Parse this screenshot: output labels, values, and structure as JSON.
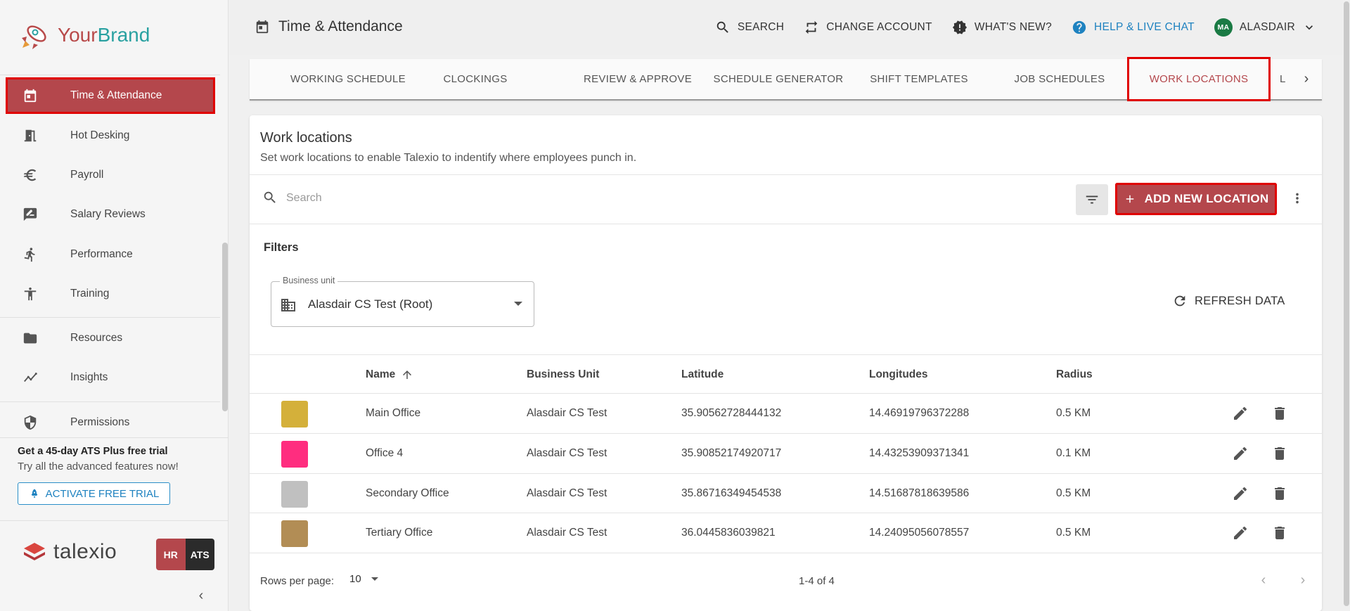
{
  "brand": {
    "part1": "Your",
    "part2": "Brand"
  },
  "sidebar": {
    "items": [
      {
        "label": "Time & Attendance",
        "icon": "calendar-icon"
      },
      {
        "label": "Hot Desking",
        "icon": "door-icon"
      },
      {
        "label": "Payroll",
        "icon": "euro-icon"
      },
      {
        "label": "Salary Reviews",
        "icon": "rate-review-icon"
      },
      {
        "label": "Performance",
        "icon": "running-person-icon"
      },
      {
        "label": "Training",
        "icon": "accessibility-icon"
      },
      {
        "label": "Resources",
        "icon": "folder-icon"
      },
      {
        "label": "Insights",
        "icon": "insights-icon"
      },
      {
        "label": "Permissions",
        "icon": "shield-icon"
      }
    ],
    "promo_title": "Get a 45-day ATS Plus free trial",
    "promo_sub": "Try all the advanced features now!",
    "trial_button": "ACTIVATE FREE TRIAL",
    "talexio": "talexio",
    "hr": "HR",
    "ats": "ATS"
  },
  "header": {
    "title": "Time & Attendance",
    "search": "SEARCH",
    "change_account": "CHANGE ACCOUNT",
    "whats_new": "WHAT'S NEW?",
    "help": "HELP & LIVE CHAT",
    "avatar_initials": "MA",
    "user": "ALASDAIR"
  },
  "tabs": [
    "WORKING SCHEDULE",
    "CLOCKINGS",
    "REVIEW & APPROVE",
    "SCHEDULE GENERATOR",
    "SHIFT TEMPLATES",
    "JOB SCHEDULES",
    "WORK LOCATIONS",
    "L"
  ],
  "card": {
    "title": "Work locations",
    "subtitle": "Set work locations to enable Talexio to indentify where employees punch in.",
    "search_placeholder": "Search",
    "add_button": "ADD NEW LOCATION",
    "filters_label": "Filters",
    "business_unit_label": "Business unit",
    "business_unit_value": "Alasdair CS Test (Root)",
    "refresh": "REFRESH DATA"
  },
  "table": {
    "columns": [
      "Name",
      "Business Unit",
      "Latitude",
      "Longitudes",
      "Radius"
    ],
    "rows": [
      {
        "color": "#d4b03a",
        "name": "Main Office",
        "business_unit": "Alasdair CS Test",
        "latitude": "35.90562728444132",
        "longitude": "14.46919796372288",
        "radius": "0.5 KM"
      },
      {
        "color": "#ff2d7f",
        "name": "Office 4",
        "business_unit": "Alasdair CS Test",
        "latitude": "35.90852174920717",
        "longitude": "14.43253909371341",
        "radius": "0.1 KM"
      },
      {
        "color": "#c0c0c0",
        "name": "Secondary Office",
        "business_unit": "Alasdair CS Test",
        "latitude": "35.86716349454538",
        "longitude": "14.51687818639586",
        "radius": "0.5 KM"
      },
      {
        "color": "#b28d55",
        "name": "Tertiary Office",
        "business_unit": "Alasdair CS Test",
        "latitude": "36.0445836039821",
        "longitude": "14.24095056078557",
        "radius": "0.5 KM"
      }
    ]
  },
  "pagination": {
    "rows_per_page_label": "Rows per page:",
    "rows_per_page": "10",
    "range": "1-4 of 4"
  },
  "colors": {
    "accent": "#b4474c",
    "highlight": "#e00000",
    "link": "#1e82c0"
  }
}
